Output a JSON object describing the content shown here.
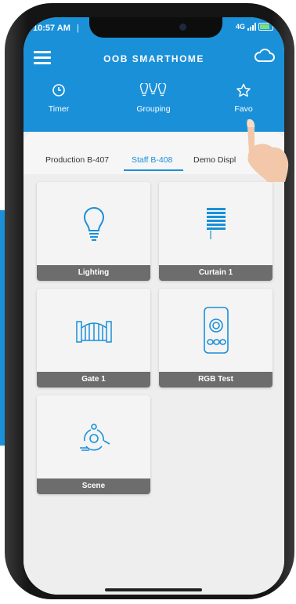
{
  "status_bar": {
    "time": "10:57 AM",
    "extra": "|",
    "network": "4G"
  },
  "header": {
    "app_title": "OOB SMARTHOME",
    "menu_icon": "hamburger-menu-icon",
    "cloud_icon": "cloud-icon"
  },
  "nav": {
    "items": [
      {
        "label": "Timer",
        "icon": "clock-icon"
      },
      {
        "label": "Grouping",
        "icon": "lightbulbs-icon"
      },
      {
        "label": "Favo",
        "icon": "star-icon"
      }
    ]
  },
  "tabs": {
    "items": [
      {
        "label": "Production B-407"
      },
      {
        "label": "Staff B-408"
      },
      {
        "label": "Demo Displ"
      }
    ],
    "active_index": 1
  },
  "devices": [
    {
      "name": "Lighting",
      "icon": "lightbulb-icon"
    },
    {
      "name": "Curtain 1",
      "icon": "curtain-icon"
    },
    {
      "name": "Gate 1",
      "icon": "gate-icon"
    },
    {
      "name": "RGB Test",
      "icon": "rgb-remote-icon"
    },
    {
      "name": "Scene",
      "icon": "scene-icon"
    }
  ],
  "colors": {
    "accent": "#1a90d9",
    "card_label_bg": "#6d6d6d",
    "content_bg": "#eeeeee"
  }
}
